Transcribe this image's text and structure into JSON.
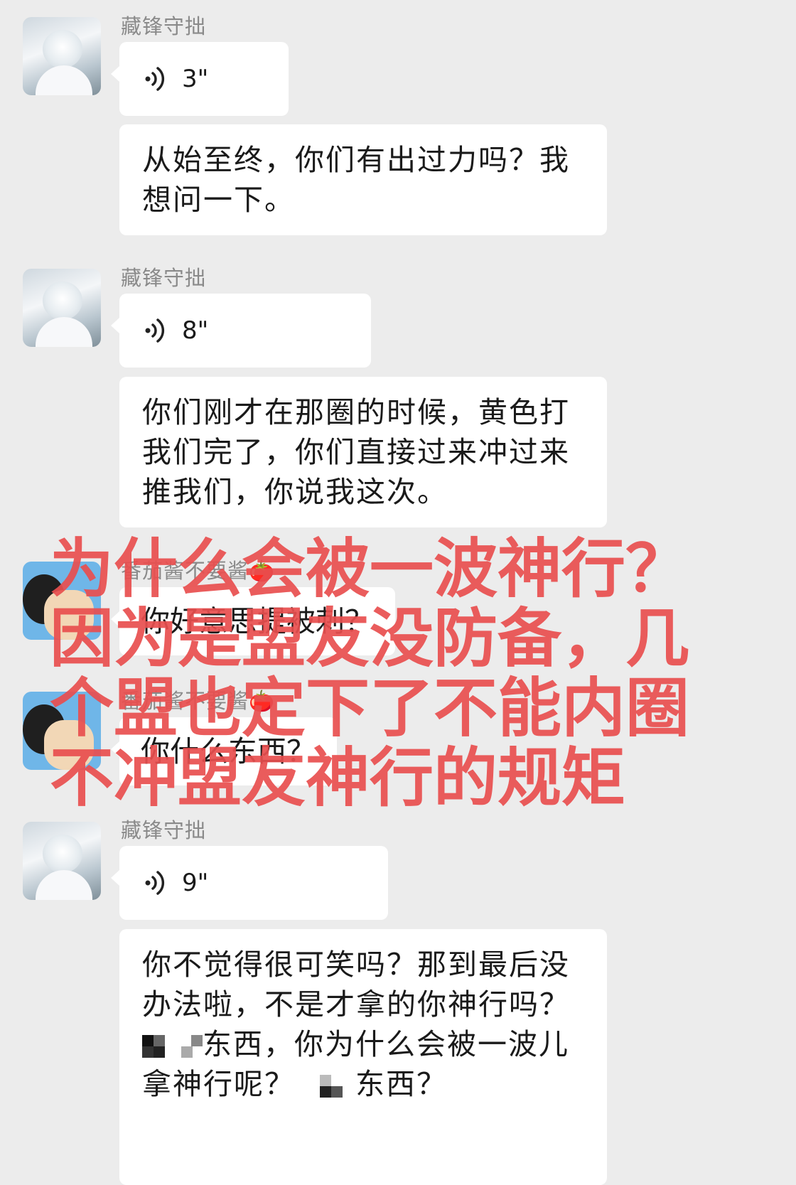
{
  "messages": [
    {
      "sender": "藏锋守拙",
      "avatar": "silver-hair-avatar",
      "voice_duration": "3\"",
      "text": "从始至终，你们有出过力吗？我想问一下。"
    },
    {
      "sender": "藏锋守拙",
      "avatar": "silver-hair-avatar",
      "voice_duration": "8\"",
      "text": "你们刚才在那圈的时候，黄色打我们完了，你们直接过来冲过来推我们，你说我这次。"
    },
    {
      "sender": "番茄酱不要酱🍅",
      "avatar": "cartoon-avatar",
      "text": "你好意思提被刺？"
    },
    {
      "sender": "番茄酱不要酱🍅",
      "avatar": "cartoon-avatar",
      "text": "你什么东西？"
    },
    {
      "sender": "藏锋守拙",
      "avatar": "silver-hair-avatar",
      "voice_duration": "9\"",
      "text_line1": "你不觉得很可笑吗？那到最后没",
      "text_line2": "办法啦，不是才拿的你神行吗？",
      "text_line3": "东西，你为什么会被一波儿",
      "text_line4a": "拿神行呢？",
      "text_line4b": "东西？"
    }
  ],
  "overlay_text": "为什么会被一波神行？因为是盟友没防备，几个盟也定下了不能内圈不冲盟友神行的规矩"
}
